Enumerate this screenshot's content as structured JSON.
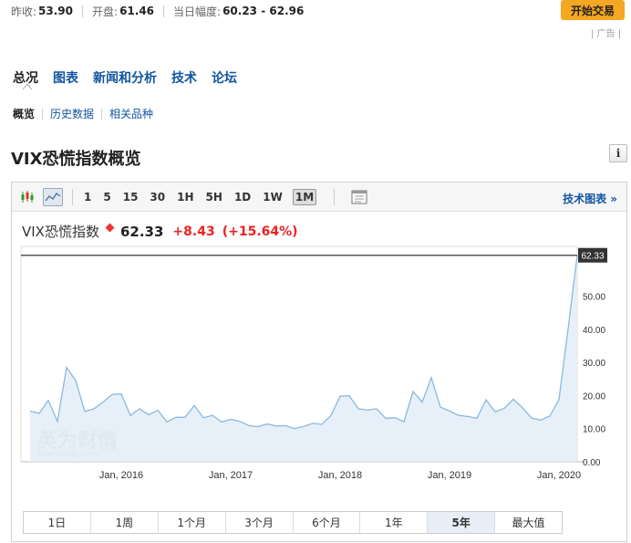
{
  "topbar": {
    "prev_close_label": "昨收:",
    "prev_close": "53.90",
    "open_label": "开盘:",
    "open": "61.46",
    "day_range_label": "当日幅度:",
    "day_range": "60.23 - 62.96"
  },
  "trade_button": "开始交易",
  "ad_label": "| 广告 |",
  "tabs": [
    "总况",
    "图表",
    "新闻和分析",
    "技术",
    "论坛"
  ],
  "subtabs": [
    "概览",
    "历史数据",
    "相关品种"
  ],
  "section_title": "VIX恐慌指数概览",
  "info_icon_glyph": "i",
  "toolbar": {
    "timeframes": [
      "1",
      "5",
      "15",
      "30",
      "1H",
      "5H",
      "1D",
      "1W",
      "1M"
    ],
    "active_timeframe": "1M",
    "tech_chart_link": "技术图表 »"
  },
  "quote": {
    "name": "VIX恐慌指数",
    "price": "62.33",
    "change": "+8.43",
    "change_pct": "(+15.64%)"
  },
  "watermark": {
    "text": "英为财情",
    "sub": "Investing",
    "sub_suffix": ".com"
  },
  "periods": [
    "1日",
    "1周",
    "1个月",
    "3个月",
    "6个月",
    "1年",
    "5年",
    "最大值"
  ],
  "active_period": "5年",
  "colors": {
    "accent": "#1256a0",
    "line": "#8bb8de",
    "fill": "#e3edf7",
    "up": "#e22222",
    "trade": "#f5a623"
  },
  "chart_data": {
    "type": "area",
    "y_ticks": [
      0,
      10,
      20,
      30,
      40,
      50
    ],
    "y_tick_labels": [
      "0.00",
      "10.00",
      "20.00",
      "30.00",
      "40.00",
      "50.00"
    ],
    "ylim": [
      0,
      65
    ],
    "x_tick_labels": [
      "Jan, 2016",
      "Jan, 2017",
      "Jan, 2018",
      "Jan, 2019",
      "Jan, 2020"
    ],
    "x_tick_dates": [
      "2016-01",
      "2017-01",
      "2018-01",
      "2019-01",
      "2020-01"
    ],
    "last_value_label": "62.33",
    "last_value": 62.33,
    "series": [
      {
        "x": [
          "2015-03",
          "2015-04",
          "2015-05",
          "2015-06",
          "2015-07",
          "2015-08",
          "2015-09",
          "2015-10",
          "2015-11",
          "2015-12",
          "2016-01",
          "2016-02",
          "2016-03",
          "2016-04",
          "2016-05",
          "2016-06",
          "2016-07",
          "2016-08",
          "2016-09",
          "2016-10",
          "2016-11",
          "2016-12",
          "2017-01",
          "2017-02",
          "2017-03",
          "2017-04",
          "2017-05",
          "2017-06",
          "2017-07",
          "2017-08",
          "2017-09",
          "2017-10",
          "2017-11",
          "2017-12",
          "2018-01",
          "2018-02",
          "2018-03",
          "2018-04",
          "2018-05",
          "2018-06",
          "2018-07",
          "2018-08",
          "2018-09",
          "2018-10",
          "2018-11",
          "2018-12",
          "2019-01",
          "2019-02",
          "2019-03",
          "2019-04",
          "2019-05",
          "2019-06",
          "2019-07",
          "2019-08",
          "2019-09",
          "2019-10",
          "2019-11",
          "2019-12",
          "2020-01",
          "2020-02",
          "2020-03"
        ],
        "values": [
          15.3,
          14.6,
          18.5,
          12.2,
          28.5,
          24.5,
          15.2,
          16.0,
          18.0,
          20.3,
          20.5,
          14.0,
          16.0,
          14.2,
          15.6,
          12.0,
          13.4,
          13.4,
          17.0,
          13.3,
          14.0,
          12.0,
          12.8,
          12.2,
          10.9,
          10.6,
          11.4,
          10.8,
          10.9,
          10.0,
          10.7,
          11.6,
          11.3,
          14.0,
          19.8,
          19.9,
          16.0,
          15.6,
          16.0,
          13.1,
          13.3,
          12.1,
          21.2,
          18.0,
          25.4,
          16.5,
          15.3,
          14.0,
          13.7,
          13.1,
          18.7,
          15.1,
          16.1,
          18.9,
          16.3,
          13.2,
          12.6,
          13.8,
          18.8,
          40.1,
          62.33
        ]
      }
    ]
  }
}
